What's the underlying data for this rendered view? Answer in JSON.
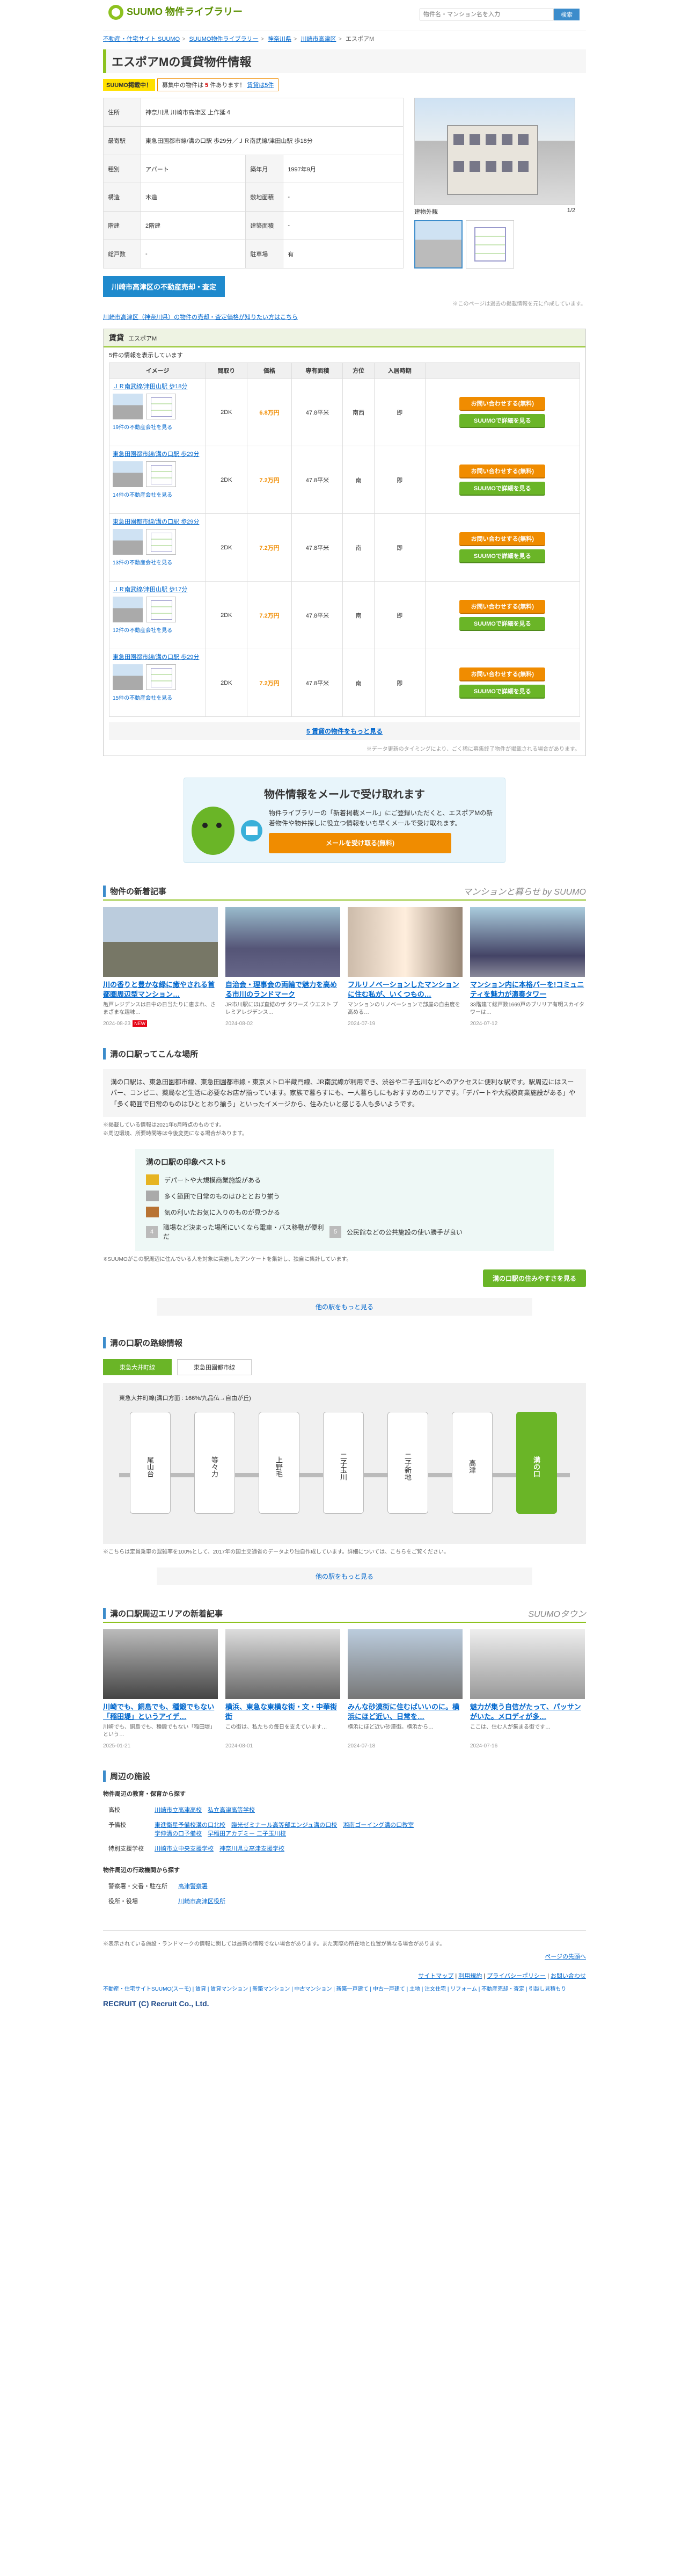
{
  "header": {
    "logo": "SUUMO 物件ライブラリー",
    "logo_sub": "ライブラリー",
    "search_placeholder": "物件名・マンション名を入力",
    "search_button": "検索"
  },
  "breadcrumb": [
    "不動産・住宅サイト SUUMO",
    "SUUMO物件ライブラリー",
    "神奈川県",
    "川崎市高津区",
    "エスポアM"
  ],
  "title": "エスポアMの賃貸物件情報",
  "notice": {
    "badge": "SUUMO掲載中！",
    "pre": "募集中の物件は",
    "count": "5",
    "post": "件あります！",
    "link": "賃貸は5件"
  },
  "spec": [
    {
      "k": "住所",
      "v": "神奈川県 川崎市高津区 上作延４"
    },
    {
      "k": "最寄駅",
      "v": "東急田園都市線/溝の口駅 歩29分／ＪＲ南武線/津田山駅 歩18分"
    },
    {
      "k": "種別",
      "v": "アパート",
      "k2": "築年月",
      "v2": "1997年9月"
    },
    {
      "k": "構造",
      "v": "木造",
      "k2": "敷地面積",
      "v2": "-"
    },
    {
      "k": "階建",
      "v": "2階建",
      "k2": "建築面積",
      "v2": "-"
    },
    {
      "k": "総戸数",
      "v": "-",
      "k2": "駐車場",
      "v2": "有"
    }
  ],
  "photo": {
    "caption": "建物外観",
    "page": "1/2"
  },
  "area_button": "川崎市高津区の不動産売却・査定",
  "photo_note": "※このページは過去の掲載情報を元に作成しています。",
  "land_link": "川崎市高津区（神奈川県）の物件の売却・査定価格が知りたい方はこちら",
  "rent": {
    "head": "賃貸",
    "name": "エスポアM",
    "count_text": "5件の情報を表示しています",
    "cols": [
      "イメージ",
      "間取り",
      "価格",
      "専有面積",
      "方位",
      "入居時期",
      ""
    ],
    "rows": [
      {
        "name": "ＪＲ南武線/津田山駅 歩18分",
        "layout": "2DK",
        "price": "6.8万円",
        "area": "47.8平米",
        "dir": "南西",
        "move": "即",
        "rest": "19件の不動産会社を見る"
      },
      {
        "name": "東急田園都市線/溝の口駅 歩29分",
        "layout": "2DK",
        "price": "7.2万円",
        "area": "47.8平米",
        "dir": "南",
        "move": "即",
        "rest": "14件の不動産会社を見る"
      },
      {
        "name": "東急田園都市線/溝の口駅 歩29分",
        "layout": "2DK",
        "price": "7.2万円",
        "area": "47.8平米",
        "dir": "南",
        "move": "即",
        "rest": "13件の不動産会社を見る"
      },
      {
        "name": "ＪＲ南武線/津田山駅 歩17分",
        "layout": "2DK",
        "price": "7.2万円",
        "area": "47.8平米",
        "dir": "南",
        "move": "即",
        "rest": "12件の不動産会社を見る"
      },
      {
        "name": "東急田園都市線/溝の口駅 歩29分",
        "layout": "2DK",
        "price": "7.2万円",
        "area": "47.8平米",
        "dir": "南",
        "move": "即",
        "rest": "15件の不動産会社を見る"
      }
    ],
    "btn_contact": "お問い合わせする(無料)",
    "btn_detail": "SUUMOで詳細を見る",
    "more": "5 賃貸の物件をもっと見る",
    "more_note": "※データ更新のタイミングにより、ごく稀に募集終了物件が掲載される場合があります。"
  },
  "mail": {
    "title": "物件情報をメールで受け取れます",
    "text": "物件ライブラリーの「新着掲載メール」にご登録いただくと、エスポアMの新着物件や物件探しに役立つ情報をいち早くメールで受け取れます。",
    "button": "メールを受け取る(無料)"
  },
  "news": {
    "title": "物件の新着記事",
    "brand": "マンションと暮らせ by SUUMO",
    "items": [
      {
        "t": "川の香りと豊かな緑に癒やされる首都圏周辺型マンション…",
        "d": "亀戸レジデンスは日中の日当たりに恵まれ、さまざまな趣味…",
        "dt": "2024-08-23",
        "new": "NEW"
      },
      {
        "t": "自治会・理事会の両輪で魅力を高める市川のランドマーク",
        "d": "JR市川駅にほぼ直結のザ タワーズ ウエスト プレミアレジデンス…",
        "dt": "2024-08-02",
        "new": ""
      },
      {
        "t": "フルリノベーションしたマンションに住む私が、いくつもの…",
        "d": "マンションのリノベーションで部屋の自由度を高める…",
        "dt": "2024-07-19",
        "new": ""
      },
      {
        "t": "マンション内に本格バーを!コミュニティを魅力が演奏タワー",
        "d": "33階建て総戸数1669戸のブリリア有明スカイタワーは…",
        "dt": "2024-07-12",
        "new": ""
      }
    ]
  },
  "town": {
    "title": "溝の口駅ってこんな場所",
    "body": "溝の口駅は、東急田園都市線、東急田園都市線・東京メトロ半蔵門線、JR南武線が利用でき、渋谷や二子玉川などへのアクセスに便利な駅です。駅周辺にはスーパー、コンビニ、薬局など生活に必要なお店が揃っています。家族で暮らすにも、一人暮らしにもおすすめのエリアです。「デパートや大規模商業施設がある」や「多く範囲で日常のものはひととおり揃う」といったイメージから、住みたいと感じる人も多いようです。",
    "note1": "※掲載している情報は2021年6月時点のものです。",
    "note2": "※周辺環境、所要時間等は今後変更になる場合があります。",
    "best_title": "溝の口駅の印象ベスト5",
    "best": [
      "デパートや大規模商業施設がある",
      "多く範囲で日常のものはひととおり揃う",
      "気の利いたお気に入りのものが見つかる",
      "職場など決まった場所にいくなら電車・バス移動が便利だ",
      "公民館などの公共施設の使い勝手が良い"
    ],
    "best_note": "※SUUMOがこの駅周辺に住んでいる人を対象に実施したアンケートを集計し、独自に集計しています。",
    "button": "溝の口駅の住みやすさを見る",
    "more": "他の駅をもっと見る"
  },
  "line": {
    "title": "溝の口駅の路線情報",
    "tabs": [
      "東急大井町線",
      "東急田園都市線"
    ],
    "label": "東急大井町線(溝口方面 : 166%/九品仏→自由が丘)",
    "stations": [
      "尾山台",
      "等々力",
      "上野毛",
      "二子玉川",
      "二子新地",
      "高津",
      "溝の口"
    ],
    "note": "※こちらは定員乗車の混雑率を100%として、2017年の国土交通省のデータより独自作成しています。詳細については、こちらをご覧ください。",
    "more": "他の駅をもっと見る"
  },
  "area_news": {
    "title": "溝の口駅周辺エリアの新着記事",
    "brand": "SUUMOタウン",
    "items": [
      {
        "t": "川崎でも、銅島でも、種鍛でもない「稲田堤」というアイデ…",
        "d": "川崎でも、銅島でも、種鍛でもない「稲田堤」という…",
        "dt": "2025-01-21"
      },
      {
        "t": "横浜、東急な東横な街・文・中華街街",
        "d": "この街は、私たちの毎日を支えています…",
        "dt": "2024-08-01"
      },
      {
        "t": "みんな砂漠街に住むばいいのに。横浜にほど近い、日常を…",
        "d": "横浜にほど近い砂漠街。横浜から…",
        "dt": "2024-07-18"
      },
      {
        "t": "魅力が集う自信がたって、パッサンがいた。メロディが多…",
        "d": "ここは、住む人が集まる街です…",
        "dt": "2024-07-16"
      }
    ]
  },
  "nearby": {
    "title": "周辺の施設",
    "edu_title": "物件周辺の教育・保育から探す",
    "edu": [
      {
        "k": "高校",
        "v": [
          "川崎市立高津高校",
          "私立高津高等学校"
        ]
      },
      {
        "k": "予備校",
        "v": [
          "東進衛星予備校溝の口北校",
          "臨光ゼミナール高等部エンジュ溝の口校",
          "湘南ゴーイング溝の口教室",
          "学伸溝の口予備校",
          "早稲田アカデミー 二子玉川校"
        ]
      },
      {
        "k": "特別支援学校",
        "v": [
          "川崎市立中央支援学校",
          "神奈川県立高津支援学校"
        ]
      }
    ],
    "admin_title": "物件周辺の行政機関から探す",
    "admin": [
      {
        "k": "警察署・交番・駐在所",
        "v": [
          "高津警察署"
        ]
      },
      {
        "k": "役所・役場",
        "v": [
          "川崎市高津区役所"
        ]
      }
    ]
  },
  "footer": {
    "note": "※表示されている施設・ランドマークの情報に関しては最新の情報でない場合があります。また実際の所在地と位置が異なる場合があります。",
    "top": "ページの先頭へ",
    "nav": [
      "サイトマップ",
      "利用規約",
      "プライバシーポリシー",
      "お問い合わせ"
    ],
    "links": "不動産・住宅サイトSUUMO(スーモ) | 賃貸 | 賃貸マンション | 新築マンション | 中古マンション | 新築一戸建て | 中古一戸建て | 土地 | 注文住宅 | リフォーム | 不動産売却・査定 | 引越し見積もり",
    "copy": "RECRUIT (C) Recruit Co., Ltd."
  }
}
